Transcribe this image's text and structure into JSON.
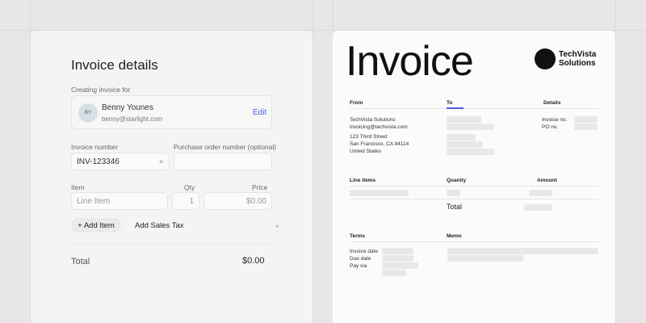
{
  "form": {
    "title": "Invoice details",
    "client_label": "Creating invoice for",
    "client": {
      "initials": "BY",
      "name": "Benny Younes",
      "email": "benny@starlight.com",
      "edit": "Edit"
    },
    "invoice_number_label": "Invoice number",
    "invoice_number": "INV-123346",
    "po_label": "Purchase order number (optional)",
    "item_label": "Item",
    "qty_label": "Qty",
    "price_label": "Price",
    "item_placeholder": "Line Item",
    "qty": "1",
    "price": "$0.00",
    "add_item": "+ Add Item",
    "add_tax": "Add Sales Tax",
    "remove": "×",
    "total_label": "Total",
    "total": "$0.00"
  },
  "preview": {
    "title": "Invoice",
    "logo": "TechVista Solutions",
    "logo_line1": "TechVista",
    "logo_line2": "Solutions",
    "from": "From",
    "to": "To",
    "details": "Details",
    "from_lines": [
      "TechVista Solutions",
      "invoicing@techvista.com",
      "123 Third Street",
      "San Francisco, CA 94114",
      "United States"
    ],
    "invoice_no": "Invoice no.",
    "po_no": "PO no.",
    "line_items": "Line items",
    "quantity": "Quanity",
    "amount": "Amount",
    "total": "Total",
    "terms": "Terms",
    "memo": "Memo",
    "invoice_date": "Invoice date",
    "due_date": "Due date",
    "pay_via": "Pay via"
  },
  "colors": {
    "accent": "#4a5be0"
  }
}
